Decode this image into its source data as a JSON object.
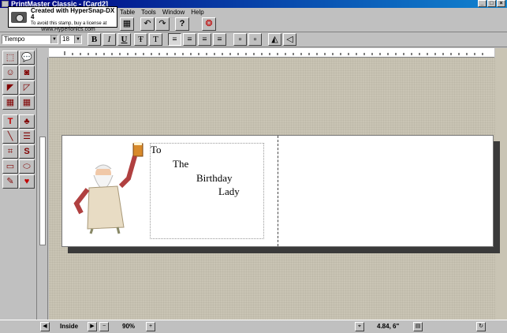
{
  "window": {
    "title": "PrintMaster Classic - [Card2]",
    "controls": [
      "_",
      "□",
      "×"
    ]
  },
  "menu": {
    "items": [
      "Table",
      "Tools",
      "Window",
      "Help"
    ]
  },
  "watermark": {
    "line1": "Created with HyperSnap-DX 4",
    "line2": "To avoid this stamp, buy a license at",
    "line3": "www.Hyperionics.com"
  },
  "toolbar": {
    "undo_icon": "↶",
    "redo_icon": "↷",
    "help_label": "?"
  },
  "format_bar": {
    "font_name": "Tiempo",
    "font_size": "18",
    "bold": "B",
    "italic": "I",
    "underline": "U"
  },
  "card": {
    "lines": [
      "To",
      "The",
      "Birthday",
      "Lady"
    ]
  },
  "status": {
    "page_label": "Inside",
    "zoom": "90%",
    "position": "4.84, 6\""
  },
  "colors": {
    "title_start": "#000080",
    "title_end": "#1084d0",
    "workspace": "#c9c4b4"
  }
}
